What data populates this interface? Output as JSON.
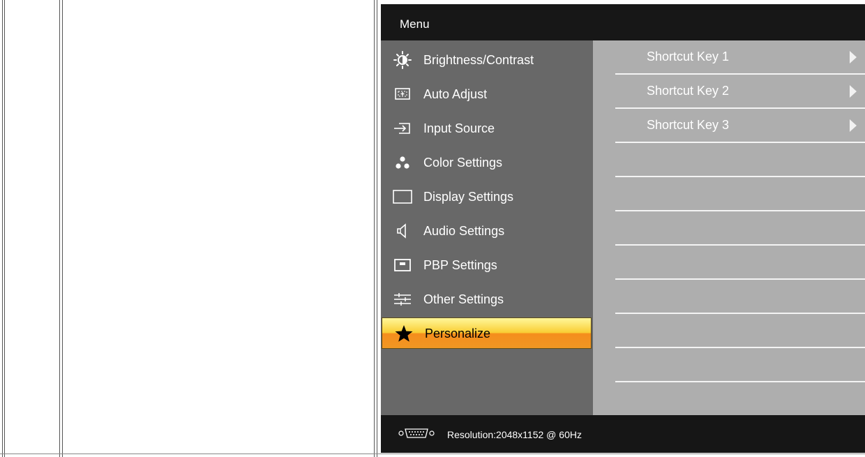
{
  "osd": {
    "title": "Menu",
    "menu_items": [
      {
        "label": "Brightness/Contrast",
        "icon": "brightness-icon"
      },
      {
        "label": "Auto Adjust",
        "icon": "auto-adjust-icon"
      },
      {
        "label": "Input Source",
        "icon": "input-source-icon"
      },
      {
        "label": "Color Settings",
        "icon": "color-settings-icon"
      },
      {
        "label": "Display Settings",
        "icon": "display-settings-icon"
      },
      {
        "label": "Audio Settings",
        "icon": "speaker-icon"
      },
      {
        "label": "PBP Settings",
        "icon": "pbp-icon"
      },
      {
        "label": "Other Settings",
        "icon": "sliders-icon"
      },
      {
        "label": "Personalize",
        "icon": "star-icon",
        "selected": true
      }
    ],
    "submenu_items": [
      {
        "label": "Shortcut Key 1"
      },
      {
        "label": "Shortcut Key 2"
      },
      {
        "label": "Shortcut Key 3"
      }
    ],
    "footer": {
      "resolution_label": "Resolution:2048x1152 @ 60Hz",
      "icon": "vga-connector-icon"
    },
    "colors": {
      "selected_top": "#fff79a",
      "selected_bottom": "#f58d1c",
      "left_panel": "#686868",
      "right_panel": "#aeaeae"
    }
  }
}
